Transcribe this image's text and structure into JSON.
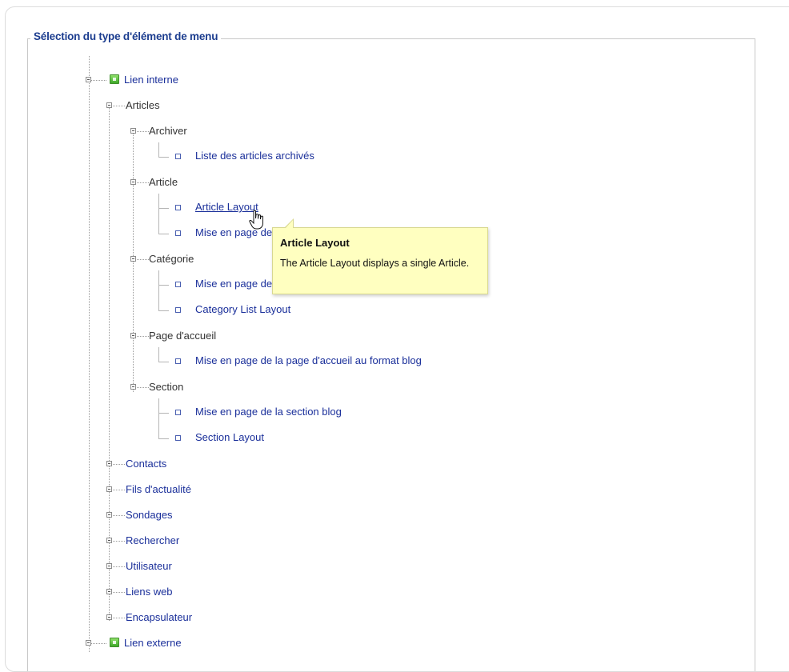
{
  "panel": {
    "legend": "Sélection du type d'élément de menu"
  },
  "tree": {
    "internal": "Lien interne",
    "articles": "Articles",
    "archiver": "Archiver",
    "archived_list": "Liste des articles archivés",
    "article": "Article",
    "article_layout": "Article Layout",
    "article_submit": "Mise en page de soumission d'article",
    "categorie": "Catégorie",
    "category_blog": "Mise en page de la catégorie blog",
    "category_list": "Category List Layout",
    "frontpage": "Page d'accueil",
    "frontpage_blog": "Mise en page de la page d'accueil au format blog",
    "section": "Section",
    "section_blog": "Mise en page de la section blog",
    "section_layout": "Section Layout",
    "contacts": "Contacts",
    "feeds": "Fils d'actualité",
    "polls": "Sondages",
    "search": "Rechercher",
    "user": "Utilisateur",
    "weblinks": "Liens web",
    "wrapper": "Encapsulateur",
    "external": "Lien externe"
  },
  "tooltip": {
    "title": "Article Layout",
    "body": "The Article Layout displays a single Article."
  }
}
